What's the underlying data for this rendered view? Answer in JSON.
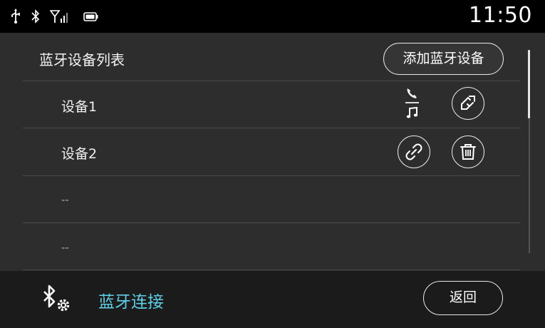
{
  "status_bar": {
    "time": "11:50",
    "icons": [
      "usb-icon",
      "bluetooth-icon",
      "signal-icon",
      "battery-icon"
    ]
  },
  "device_list": {
    "title": "蓝牙设备列表",
    "add_button_label": "添加蓝牙设备",
    "rows": [
      {
        "label": "设备1",
        "actions": [
          "phone-icon",
          "music-icon",
          "disconnect-icon"
        ]
      },
      {
        "label": "设备2",
        "actions": [
          "connect-link-icon",
          "delete-icon"
        ]
      },
      {
        "label": "--"
      },
      {
        "label": "--"
      }
    ]
  },
  "bottom_bar": {
    "title": "蓝牙连接",
    "icon": "bluetooth-settings-icon",
    "back_label": "返回"
  },
  "colors": {
    "accent": "#5fd0e6",
    "background": "#2d2d2d",
    "status_bar": "#000000",
    "bottom_bar": "#1b1b1b"
  }
}
